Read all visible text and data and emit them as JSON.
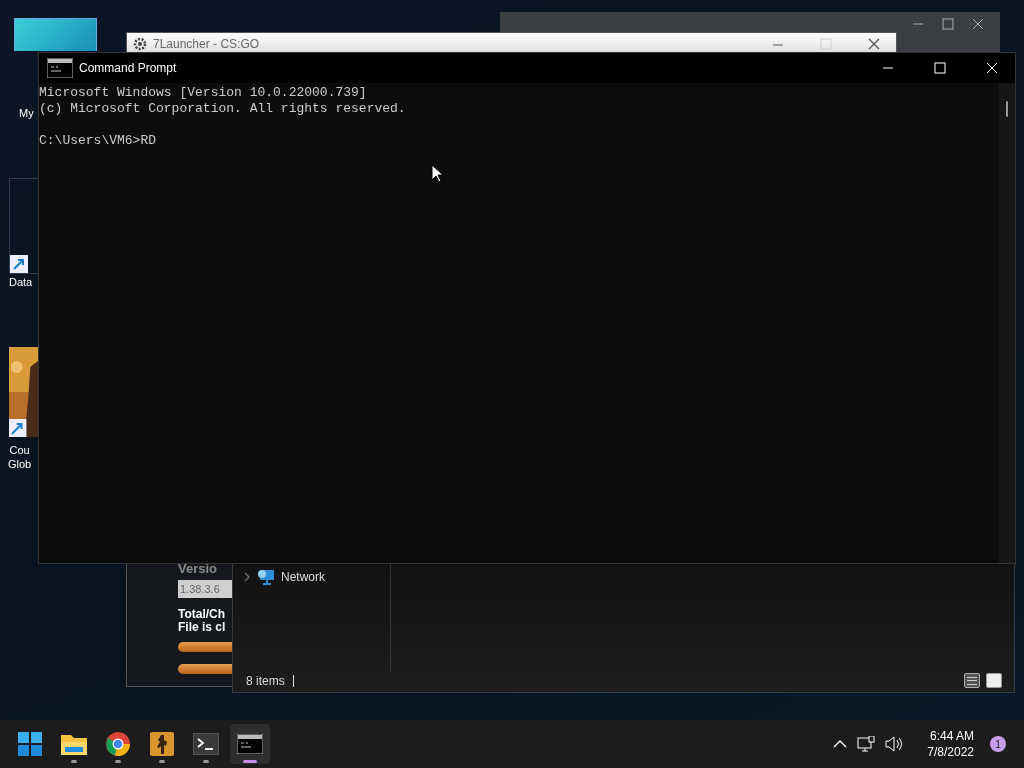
{
  "desktop_icons": [
    {
      "kind": "teal",
      "lines": [
        "My"
      ]
    },
    {
      "kind": "shortcut",
      "lines": [
        "Data"
      ]
    },
    {
      "kind": "game",
      "lines": [
        "Cou",
        "Glob"
      ]
    }
  ],
  "launcher": {
    "title": "7Launcher - CS:GO",
    "version_label": "Versio",
    "version_value": "1.38.3.6",
    "status_lines": [
      "Total/Ch",
      "File is cl"
    ]
  },
  "explorer": {
    "nav_items": [
      {
        "label": "Network",
        "expanded": false
      }
    ],
    "status": "8 items",
    "views": [
      {
        "kind": "details",
        "selected": false
      },
      {
        "kind": "tiles",
        "selected": true
      }
    ]
  },
  "console": {
    "title": "Command Prompt",
    "lines": [
      "Microsoft Windows [Version 10.0.22000.739]",
      "(c) Microsoft Corporation. All rights reserved."
    ],
    "prompt": "C:\\Users\\VM6>RD"
  },
  "taskbar": {
    "apps": [
      {
        "kind": "start",
        "running": false,
        "selected": false
      },
      {
        "kind": "folder",
        "running": true,
        "selected": false
      },
      {
        "kind": "chrome",
        "running": true,
        "selected": false
      },
      {
        "kind": "game",
        "running": true,
        "selected": false
      },
      {
        "kind": "terminal",
        "running": true,
        "selected": false
      },
      {
        "kind": "console",
        "running": true,
        "selected": true
      }
    ],
    "time": "6:44 AM",
    "date": "7/8/2022",
    "notifications": "1"
  }
}
